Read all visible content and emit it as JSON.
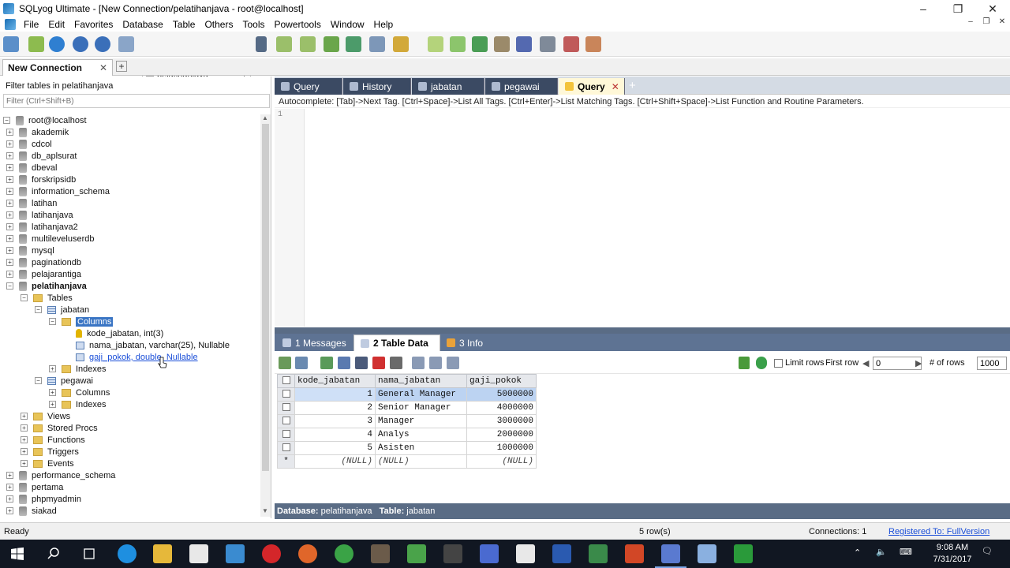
{
  "window": {
    "title": "SQLyog Ultimate - [New Connection/pelatihanjava - root@localhost]",
    "min": "–",
    "max": "❐",
    "close": "✕"
  },
  "menu": [
    "File",
    "Edit",
    "Favorites",
    "Database",
    "Table",
    "Others",
    "Tools",
    "Powertools",
    "Window",
    "Help"
  ],
  "toolbar": {
    "db_selected": "pelatihanjava"
  },
  "connection_tab": {
    "label": "New Connection",
    "close": "✕",
    "add": "+"
  },
  "filter": {
    "label": "Filter tables in pelatihanjava",
    "placeholder": "Filter (Ctrl+Shift+B)"
  },
  "tree": {
    "root": "root@localhost",
    "databases_top": [
      "akademik",
      "cdcol",
      "db_aplsurat",
      "dbeval",
      "forskripsidb",
      "information_schema",
      "latihan",
      "latihanjava",
      "latihanjava2",
      "multileveluserdb",
      "mysql",
      "paginationdb",
      "pelajarantiga"
    ],
    "current_db": "pelatihanjava",
    "tables_folder": "Tables",
    "table1": "jabatan",
    "columns_folder": "Columns",
    "columns": [
      "kode_jabatan, int(3)",
      "nama_jabatan, varchar(25), Nullable",
      "gaji_pokok, double, Nullable"
    ],
    "indexes": "Indexes",
    "table2": "pegawai",
    "table2_columns": "Columns",
    "table2_indexes": "Indexes",
    "other_folders": [
      "Views",
      "Stored Procs",
      "Functions",
      "Triggers",
      "Events"
    ],
    "databases_bottom": [
      "performance_schema",
      "pertama",
      "phpmyadmin",
      "siakad"
    ]
  },
  "query_tabs": [
    {
      "label": "Query",
      "active": false,
      "closable": false
    },
    {
      "label": "History",
      "active": false,
      "closable": false
    },
    {
      "label": "jabatan",
      "active": false,
      "closable": false
    },
    {
      "label": "pegawai",
      "active": false,
      "closable": false
    },
    {
      "label": "Query",
      "active": true,
      "closable": true
    }
  ],
  "autocomplete_hint": "Autocomplete: [Tab]->Next Tag. [Ctrl+Space]->List All Tags. [Ctrl+Enter]->List Matching Tags. [Ctrl+Shift+Space]->List Function and Routine Parameters.",
  "editor": {
    "line_number": "1"
  },
  "result_tabs": [
    {
      "label": "1 Messages",
      "active": false
    },
    {
      "label": "2 Table Data",
      "active": true
    },
    {
      "label": "3 Info",
      "active": false
    }
  ],
  "result_toolbar": {
    "limit_rows_label": "Limit rows",
    "first_row_label": "First row",
    "first_row_value": "0",
    "num_rows_label": "# of rows",
    "num_rows_value": "1000"
  },
  "grid": {
    "columns": [
      "kode_jabatan",
      "nama_jabatan",
      "gaji_pokok"
    ],
    "rows": [
      [
        "1",
        "General Manager",
        "5000000"
      ],
      [
        "2",
        "Senior Manager",
        "4000000"
      ],
      [
        "3",
        "Manager",
        "3000000"
      ],
      [
        "4",
        "Analys",
        "2000000"
      ],
      [
        "5",
        "Asisten",
        "1000000"
      ]
    ],
    "new_row": [
      "(NULL)",
      "(NULL)",
      "(NULL)"
    ],
    "new_row_marker": "*"
  },
  "grid_footer": {
    "db_label": "Database:",
    "db_value": "pelatihanjava",
    "table_label": "Table:",
    "table_value": "jabatan"
  },
  "status": {
    "ready": "Ready",
    "rows": "5 row(s)",
    "connections": "Connections: 1",
    "registered": "Registered To: FullVersion"
  },
  "taskbar": {
    "time": "9:08 AM",
    "date": "7/31/2017"
  },
  "colors": {
    "accent": "#3a75c4",
    "tab_dark": "#3b4a63",
    "result_bar": "#5e7393"
  }
}
